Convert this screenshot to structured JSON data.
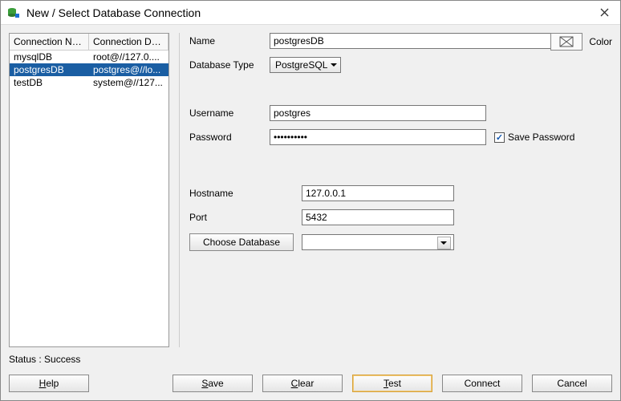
{
  "window": {
    "title": "New / Select Database Connection"
  },
  "connections": {
    "header_name": "Connection Na...",
    "header_detail": "Connection De...",
    "rows": [
      {
        "name": "mysqlDB",
        "detail": "root@//127.0...."
      },
      {
        "name": "postgresDB",
        "detail": "postgres@//lo..."
      },
      {
        "name": "testDB",
        "detail": "system@//127..."
      }
    ],
    "selected_index": 1
  },
  "form": {
    "name_label": "Name",
    "name_value": "postgresDB",
    "dbtype_label": "Database Type",
    "dbtype_value": "PostgreSQL",
    "color_label": "Color",
    "username_label": "Username",
    "username_value": "postgres",
    "password_label": "Password",
    "password_value": "••••••••••",
    "save_password_label": "Save Password",
    "save_password_checked": true,
    "hostname_label": "Hostname",
    "hostname_value": "127.0.0.1",
    "port_label": "Port",
    "port_value": "5432",
    "choose_db_label": "Choose Database",
    "choose_db_value": ""
  },
  "status": {
    "text": "Status : Success"
  },
  "buttons": {
    "help": "Help",
    "save": "Save",
    "clear": "Clear",
    "test": "Test",
    "connect": "Connect",
    "cancel": "Cancel"
  }
}
